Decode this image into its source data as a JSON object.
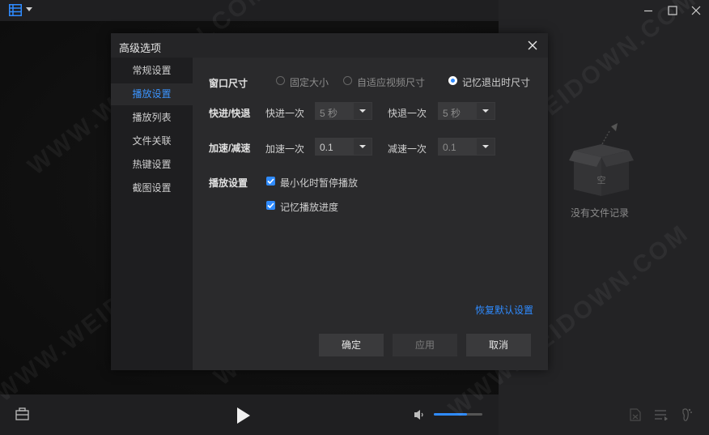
{
  "window": {
    "empty_text": "没有文件记录",
    "empty_box_label": "空",
    "volume_level": 0.68,
    "accent_color": "#2f8bff"
  },
  "watermark": "WWW.WEIDOWN.COM",
  "dialog": {
    "title": "高级选项",
    "nav": [
      {
        "label": "常规设置"
      },
      {
        "label": "播放设置"
      },
      {
        "label": "播放列表"
      },
      {
        "label": "文件关联"
      },
      {
        "label": "热键设置"
      },
      {
        "label": "截图设置"
      }
    ],
    "active_nav": "播放设置",
    "window_size": {
      "label": "窗口尺寸",
      "options": [
        "固定大小",
        "自适应视频尺寸",
        "记忆退出时尺寸"
      ],
      "selected": "记忆退出时尺寸"
    },
    "seek": {
      "label": "快进/快退",
      "forward_label": "快进一次",
      "forward_value": "5 秒",
      "backward_label": "快退一次",
      "backward_value": "5 秒"
    },
    "speed": {
      "label": "加速/减速",
      "up_label": "加速一次",
      "up_value": "0.1",
      "down_label": "减速一次",
      "down_value": "0.1"
    },
    "playback": {
      "label": "播放设置",
      "opt1": "最小化时暂停播放",
      "opt2": "记忆播放进度"
    },
    "restore_default": "恢复默认设置",
    "buttons": {
      "ok": "确定",
      "apply": "应用",
      "cancel": "取消"
    }
  }
}
